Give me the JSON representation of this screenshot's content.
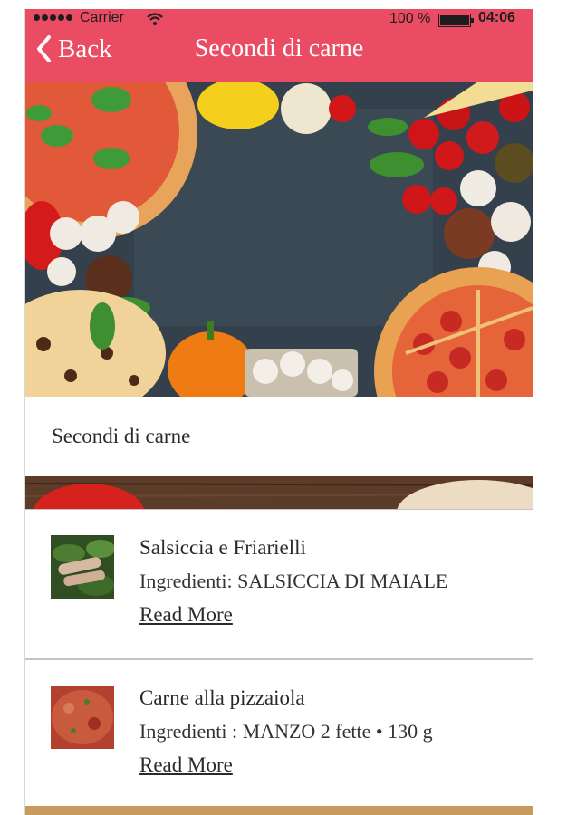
{
  "status_bar": {
    "carrier": "Carrier",
    "battery": "100 %",
    "time": "04:06"
  },
  "navbar": {
    "back_label": "Back",
    "title": "Secondi di carne",
    "color": "#ea4d63"
  },
  "section": {
    "title": "Secondi di carne"
  },
  "items": [
    {
      "title": "Salsiccia e Friarielli",
      "ingredients": "Ingredienti:  SALSICCIA DI MAIALE",
      "read_more": "Read More"
    },
    {
      "title": "Carne alla pizzaiola",
      "ingredients": "Ingredienti :  MANZO 2 fette • 130 g",
      "read_more": "Read More"
    }
  ]
}
